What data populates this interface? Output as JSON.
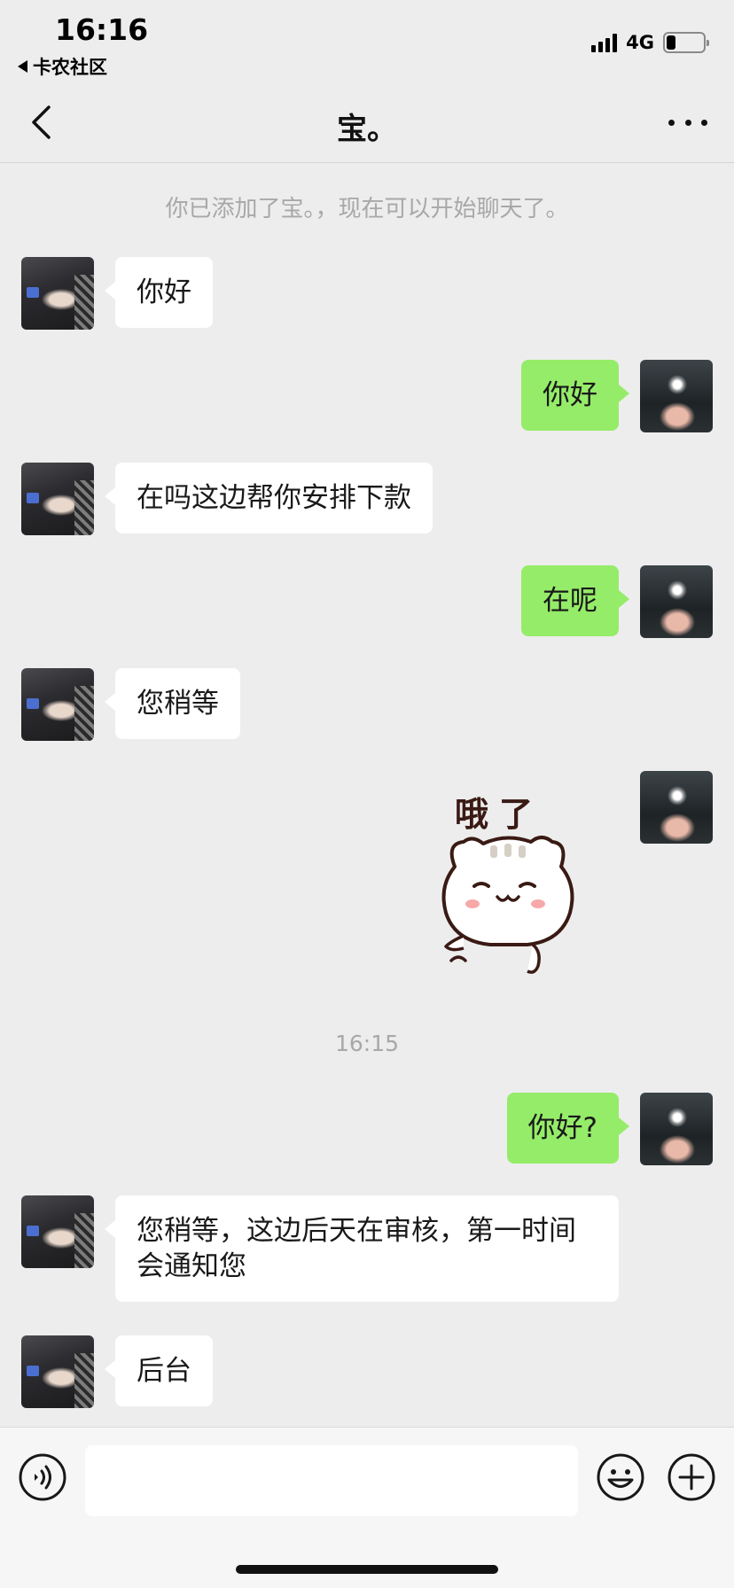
{
  "status_bar": {
    "time": "16:16",
    "back_app": "卡农社区",
    "network": "4G",
    "battery_level": 0.25
  },
  "nav": {
    "title": "宝。"
  },
  "chat": {
    "system_notice": "你已添加了宝。，现在可以开始聊天了。",
    "timestamp": "16:15",
    "messages": [
      {
        "side": "left",
        "text": "你好"
      },
      {
        "side": "right",
        "text": "你好"
      },
      {
        "side": "left",
        "text": "在吗这边帮你安排下款"
      },
      {
        "side": "right",
        "text": "在呢"
      },
      {
        "side": "left",
        "text": "您稍等"
      },
      {
        "side": "right",
        "type": "sticker",
        "text": "哦了"
      },
      {
        "side": "right",
        "text": "你好?"
      },
      {
        "side": "left",
        "text": "您稍等，这边后天在审核，第一时间会通知您"
      },
      {
        "side": "left",
        "text": "后台"
      }
    ]
  },
  "colors": {
    "background": "#ededed",
    "self_bubble": "#95ec69",
    "other_bubble": "#ffffff"
  },
  "icons": {
    "back": "chevron-left-icon",
    "more": "more-dots-icon",
    "voice": "voice-icon",
    "emoji": "emoji-icon",
    "plus": "plus-icon"
  }
}
